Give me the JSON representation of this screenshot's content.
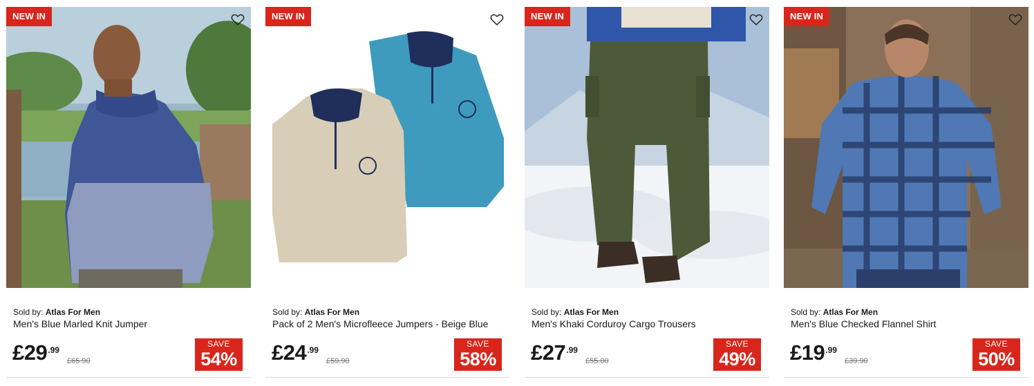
{
  "products": [
    {
      "badge": "NEW IN",
      "seller_prefix": "Sold by:",
      "seller": "Atlas For Men",
      "title": "Men's Blue Marled Knit Jumper",
      "price_main": "£29",
      "price_pence": ".99",
      "was_price": "£65.90",
      "save_label": "SAVE",
      "save_pct": "54%",
      "image_icon": "man-in-blue-marled-jumper"
    },
    {
      "badge": "NEW IN",
      "seller_prefix": "Sold by:",
      "seller": "Atlas For Men",
      "title": "Pack of 2 Men's Microfleece Jumpers - Beige Blue",
      "price_main": "£24",
      "price_pence": ".99",
      "was_price": "£59.90",
      "save_label": "SAVE",
      "save_pct": "58%",
      "image_icon": "two-microfleece-jumpers"
    },
    {
      "badge": "NEW IN",
      "seller_prefix": "Sold by:",
      "seller": "Atlas For Men",
      "title": "Men's Khaki Corduroy Cargo Trousers",
      "price_main": "£27",
      "price_pence": ".99",
      "was_price": "£55.00",
      "save_label": "SAVE",
      "save_pct": "49%",
      "image_icon": "khaki-cargo-trousers-in-snow"
    },
    {
      "badge": "NEW IN",
      "seller_prefix": "Sold by:",
      "seller": "Atlas For Men",
      "title": "Men's Blue Checked Flannel Shirt",
      "price_main": "£19",
      "price_pence": ".99",
      "was_price": "£39.90",
      "save_label": "SAVE",
      "save_pct": "50%",
      "image_icon": "man-in-blue-checked-shirt"
    }
  ],
  "colors": {
    "badge_red": "#d8261c",
    "text": "#1a1a1a",
    "was_grey": "#777777"
  },
  "icons": {
    "wishlist": "heart-outline-icon"
  }
}
